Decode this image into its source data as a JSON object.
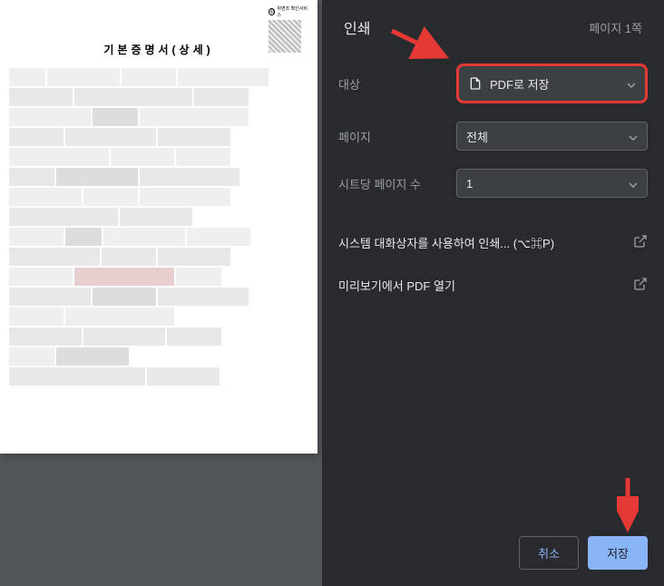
{
  "preview": {
    "doc_title": "기본증명서(상세)",
    "qr_label": "위변조 확인서비스"
  },
  "panel": {
    "title": "인쇄",
    "page_count": "페이지 1쪽",
    "destination": {
      "label": "대상",
      "value": "PDF로 저장"
    },
    "pages": {
      "label": "페이지",
      "value": "전체"
    },
    "per_sheet": {
      "label": "시트당 페이지 수",
      "value": "1"
    },
    "system_dialog": "시스템 대화상자를 사용하여 인쇄... (⌥⌘P)",
    "open_preview": "미리보기에서 PDF 열기",
    "cancel": "취소",
    "save": "저장"
  }
}
